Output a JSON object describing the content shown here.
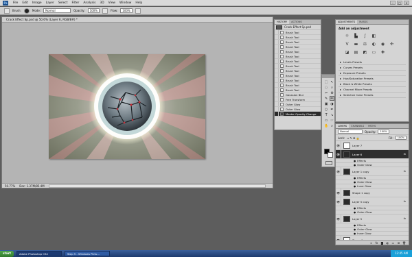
{
  "menu": [
    "File",
    "Edit",
    "Image",
    "Layer",
    "Select",
    "Filter",
    "Analysis",
    "3D",
    "View",
    "Window",
    "Help"
  ],
  "options": {
    "brush_label": "Brush:",
    "mode_label": "Mode:",
    "mode_value": "Normal",
    "opacity_label": "Opacity:",
    "opacity_value": "100%",
    "flow_label": "Flow:",
    "flow_value": "100%"
  },
  "document": {
    "title": "Crack Effect Sp.psd @ 50.6% (Layer 6, RGB/8#) *",
    "zoom": "50.77%",
    "doc_size": "Doc: 1.37M/85.4M"
  },
  "history": {
    "tabs": [
      "HISTORY",
      "ACTIONS"
    ],
    "snapshot": "Crack Effect Sp.psd",
    "items": [
      "Brush Tool",
      "Brush Tool",
      "Brush Tool",
      "Brush Tool",
      "Brush Tool",
      "Brush Tool",
      "Brush Tool",
      "Brush Tool",
      "Brush Tool",
      "Brush Tool",
      "Brush Tool",
      "Brush Tool",
      "Brush Tool",
      "Gaussian Blur",
      "Free Transform",
      "Outer Glow",
      "Outer Glow",
      "Master Opacity Change"
    ]
  },
  "tools": [
    "⬚",
    "↖",
    "◌",
    "⌕",
    "✂",
    "⊕",
    "✎",
    "✏",
    "▣",
    "◑",
    "○",
    "✒",
    "T",
    "↘",
    "▭",
    "☞",
    "✋",
    "⌕"
  ],
  "colors": {
    "foreground": "#000000",
    "background": "#ffffff",
    "accent": "#2d2d2d"
  },
  "adjustments": {
    "tabs": [
      "ADJUSTMENTS",
      "MASKS"
    ],
    "header": "Add an adjustment",
    "presets": [
      "Levels Presets",
      "Curves Presets",
      "Exposure Presets",
      "Hue/Saturation Presets",
      "Black & White Presets",
      "Channel Mixer Presets",
      "Selective Color Presets"
    ]
  },
  "layers": {
    "tabs": [
      "LAYERS",
      "CHANNELS",
      "PATHS"
    ],
    "blend_mode": "Normal",
    "opacity_label": "Opacity:",
    "opacity": "100%",
    "lock_label": "Lock:",
    "fill_label": "Fill:",
    "fill": "100%",
    "rows": [
      {
        "kind": "layer",
        "name": "Layer 7",
        "thumb": "white"
      },
      {
        "kind": "layer",
        "name": "Layer 6",
        "thumb": "dark",
        "selected": true,
        "fx": true
      },
      {
        "kind": "sub",
        "name": "Effects"
      },
      {
        "kind": "sub",
        "name": "Outer Glow"
      },
      {
        "kind": "layer",
        "name": "Layer 1 copy",
        "thumb": "dark",
        "fx": true
      },
      {
        "kind": "sub",
        "name": "Effects"
      },
      {
        "kind": "sub",
        "name": "Outer Glow"
      },
      {
        "kind": "sub",
        "name": "Inner Glow"
      },
      {
        "kind": "layer",
        "name": "Shape 1 copy",
        "thumb": "dark"
      },
      {
        "kind": "layer",
        "name": "Layer 5 copy",
        "thumb": "dark",
        "fx": true
      },
      {
        "kind": "sub",
        "name": "Effects"
      },
      {
        "kind": "sub",
        "name": "Outer Glow"
      },
      {
        "kind": "layer",
        "name": "Layer 5",
        "thumb": "dark",
        "fx": true
      },
      {
        "kind": "sub",
        "name": "Effects"
      },
      {
        "kind": "sub",
        "name": "Outer Glow"
      },
      {
        "kind": "sub",
        "name": "Inner Glow"
      },
      {
        "kind": "layer",
        "name": "Shape 1",
        "thumb": "white"
      }
    ]
  },
  "taskbar": {
    "start": "start",
    "tasks": [
      "Adobe Photoshop CS4",
      "Step 5 - Windows Pictu..."
    ],
    "clock": "12:45 AM"
  }
}
